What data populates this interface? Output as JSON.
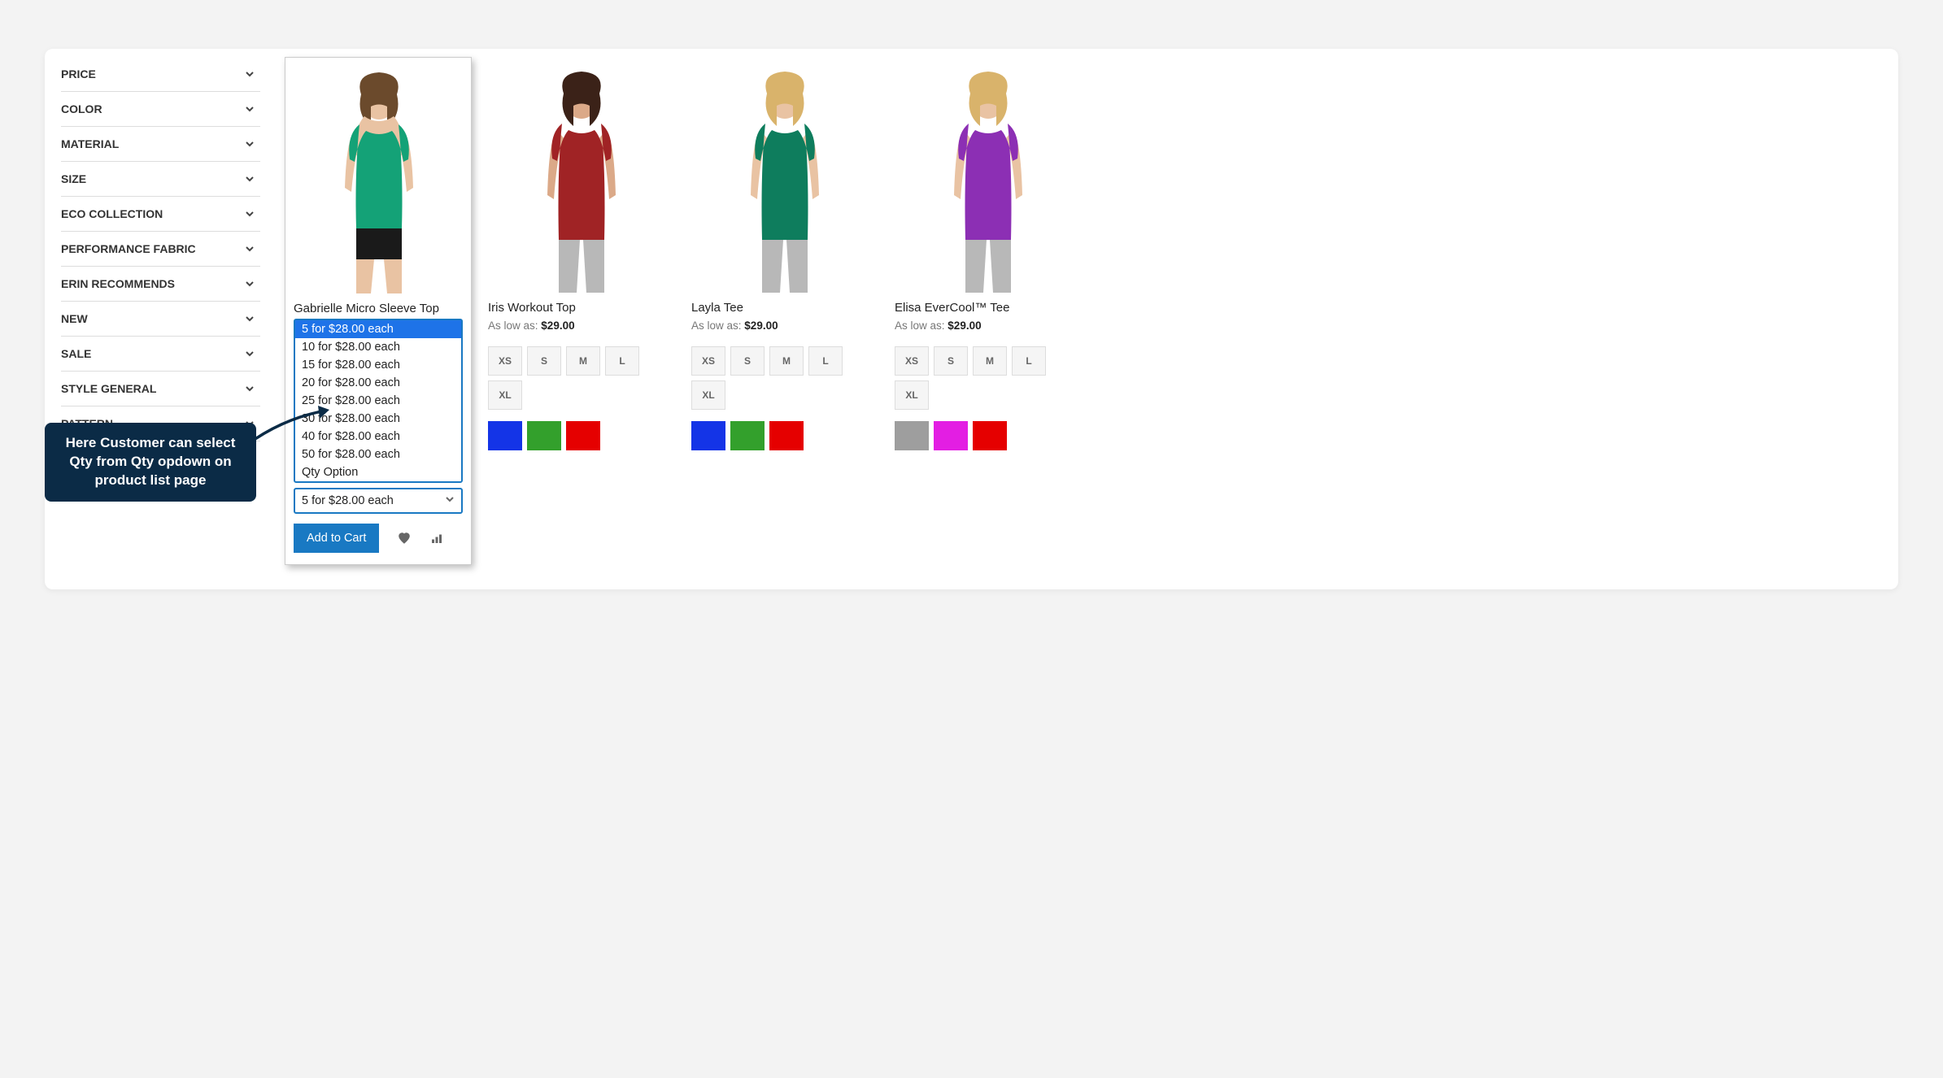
{
  "filters": [
    {
      "label": "PRICE"
    },
    {
      "label": "COLOR"
    },
    {
      "label": "MATERIAL"
    },
    {
      "label": "SIZE"
    },
    {
      "label": "ECO COLLECTION"
    },
    {
      "label": "PERFORMANCE FABRIC"
    },
    {
      "label": "ERIN RECOMMENDS"
    },
    {
      "label": "NEW"
    },
    {
      "label": "SALE"
    },
    {
      "label": "STYLE GENERAL"
    },
    {
      "label": "PATTERN"
    }
  ],
  "callout_text": "Here Customer can select Qty from Qty opdown on product list page",
  "as_low_as_label": "As low as:",
  "sizes": [
    "XS",
    "S",
    "M",
    "L",
    "XL"
  ],
  "add_to_cart_label": "Add to Cart",
  "products": [
    {
      "name": "Gabrielle Micro Sleeve Top",
      "shirt_color": "#14a277",
      "hair": "#6b4a2c",
      "skin": "#e9c3a3",
      "qty_options": [
        "5 for $28.00 each",
        "10 for $28.00 each",
        "15 for $28.00 each",
        "20 for $28.00 each",
        "25 for $28.00 each",
        "30 for $28.00 each",
        "40 for $28.00 each",
        "50 for $28.00 each",
        "Qty Option"
      ],
      "qty_selected": "5 for $28.00 each"
    },
    {
      "name": "Iris Workout Top",
      "price": "$29.00",
      "shirt_color": "#a02325",
      "hair": "#3b2218",
      "skin": "#dba988",
      "colors": [
        "#1434e7",
        "#33a02c",
        "#e50000"
      ]
    },
    {
      "name": "Layla Tee",
      "price": "$29.00",
      "shirt_color": "#0e7d5d",
      "hair": "#d9b36b",
      "skin": "#e9c3a3",
      "colors": [
        "#1434e7",
        "#33a02c",
        "#e50000"
      ]
    },
    {
      "name": "Elisa EverCool™ Tee",
      "price": "$29.00",
      "shirt_color": "#8c2fb4",
      "hair": "#d9b36b",
      "skin": "#e9c3a3",
      "colors": [
        "#9e9e9e",
        "#e31ee3",
        "#e50000"
      ]
    }
  ],
  "row2_colors": [
    "#1a1a1a",
    "#d64b8a",
    "#1d7dcf",
    "#dd7f9e"
  ]
}
